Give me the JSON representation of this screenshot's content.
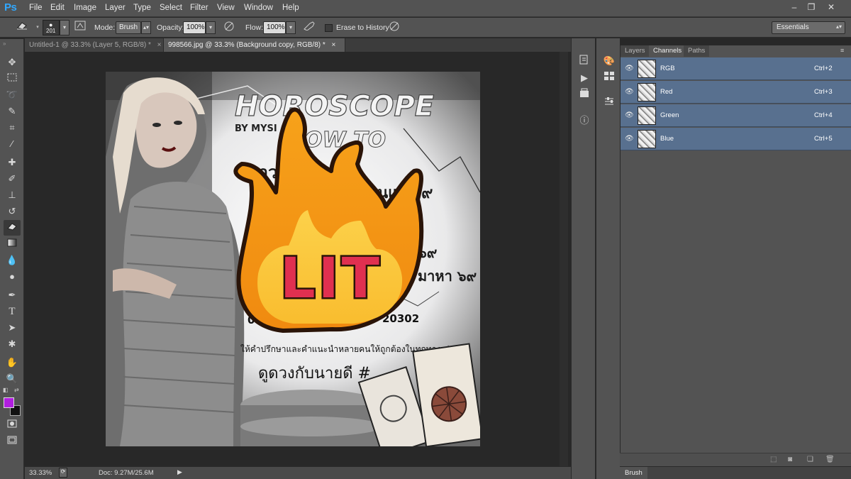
{
  "app": {
    "logo": "Ps"
  },
  "menu": [
    "File",
    "Edit",
    "Image",
    "Layer",
    "Type",
    "Select",
    "Filter",
    "View",
    "Window",
    "Help"
  ],
  "window_controls": {
    "minimize": "–",
    "restore": "❐",
    "close": "✕"
  },
  "options": {
    "brush_size": "201",
    "mode_label": "Mode:",
    "mode_value": "Brush",
    "opacity_label": "Opacity:",
    "opacity_value": "100%",
    "flow_label": "Flow:",
    "flow_value": "100%",
    "erase_history_label": "Erase to History",
    "workspace": "Essentials"
  },
  "tabs": [
    {
      "label": "Untitled-1 @ 33.3% (Layer 5, RGB/8) *",
      "close": "×",
      "active": false
    },
    {
      "label": "998566.jpg @ 33.3% (Background copy, RGB/8) *",
      "close": "×",
      "active": true
    }
  ],
  "colors": {
    "foreground": "#b11fe0",
    "background": "#111111",
    "selected_row": "#58708f"
  },
  "status": {
    "zoom": "33.33%",
    "doc": "Doc: 9.27M/25.6M"
  },
  "canvas_art": {
    "heading": "HOROSCOPE",
    "subheading": "HOW TO",
    "byline": "BY MYSI",
    "phone": "0931",
    "phone_tail": "20302",
    "sticker_text": "LIT",
    "thai_line1": "ดาวคู่",
    "thai_line2": "งานและ ๙",
    "thai_line3": "๖๙",
    "thai_line4": "มาหา ๖๙",
    "thai_bottom": "ให้คำปรึกษาและคำแนะนำหลายคนให้ถูกต้องในทุกทางเช่น",
    "thai_title": "ดูดวงกับนายดี #"
  },
  "panels": {
    "tabs": [
      {
        "label": "Layers",
        "active": false
      },
      {
        "label": "Channels",
        "active": true
      },
      {
        "label": "Paths",
        "active": false
      }
    ],
    "channels": [
      {
        "name": "RGB",
        "shortcut": "Ctrl+2"
      },
      {
        "name": "Red",
        "shortcut": "Ctrl+3"
      },
      {
        "name": "Green",
        "shortcut": "Ctrl+4"
      },
      {
        "name": "Blue",
        "shortcut": "Ctrl+5"
      }
    ],
    "brush_label": "Brush"
  }
}
